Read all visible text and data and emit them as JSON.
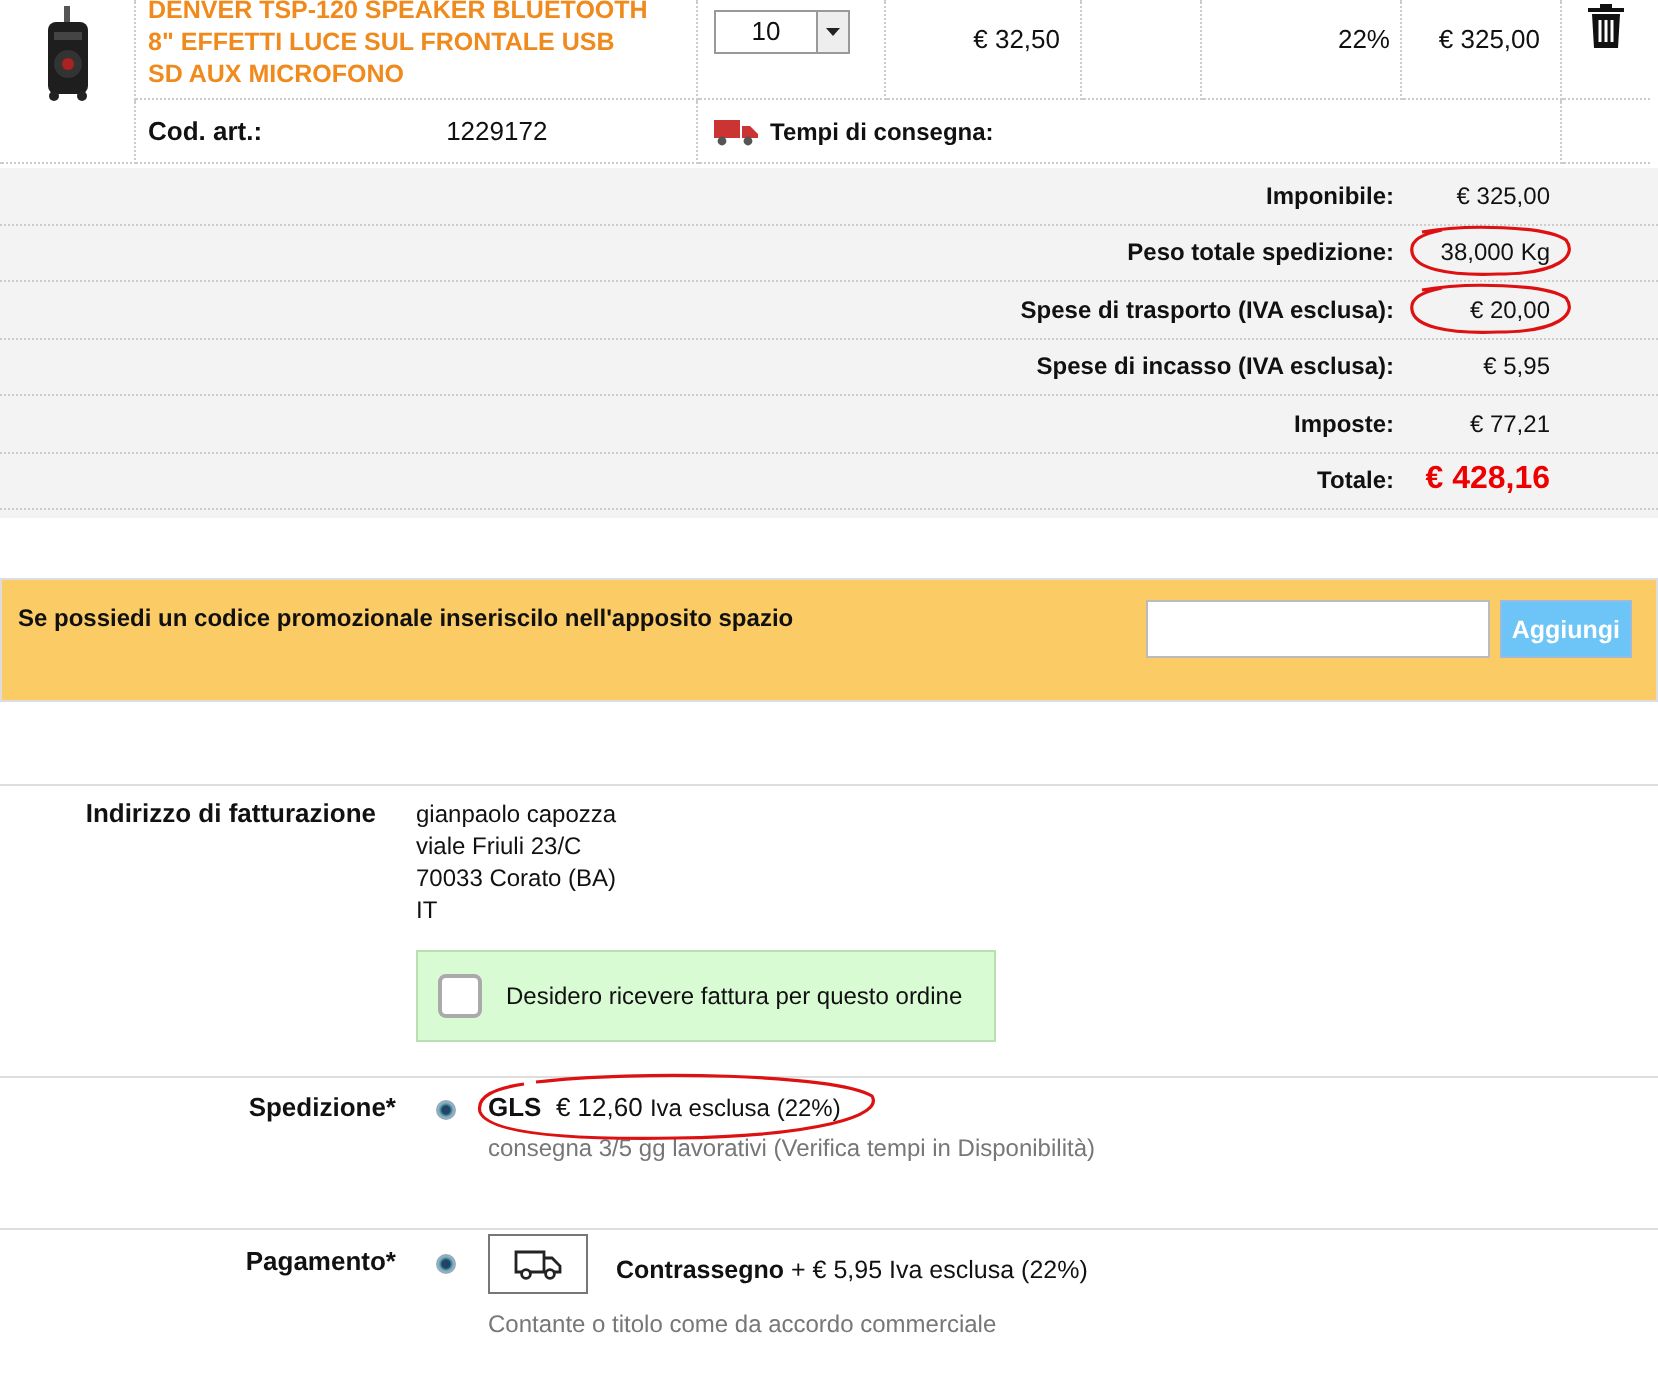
{
  "product": {
    "name": "DENVER TSP-120 SPEAKER BLUETOOTH 8\" EFFETTI LUCE SUL FRONTALE USB SD AUX MICROFONO",
    "quantity": "10",
    "unit_price": "€ 32,50",
    "vat": "22%",
    "total": "€ 325,00",
    "code_label": "Cod. art.:",
    "code": "1229172",
    "delivery_label": "Tempi di consegna:"
  },
  "summary": [
    {
      "label": "Imponibile:",
      "value": "€ 325,00",
      "kind": "normal",
      "circled": false
    },
    {
      "label": "Peso totale spedizione:",
      "value": "38,000 Kg",
      "kind": "normal",
      "circled": true
    },
    {
      "label": "Spese di trasporto (IVA esclusa):",
      "value": "€ 20,00",
      "kind": "normal",
      "circled": true
    },
    {
      "label": "Spese di incasso (IVA esclusa):",
      "value": "€ 5,95",
      "kind": "normal",
      "circled": false
    },
    {
      "label": "Imposte:",
      "value": "€ 77,21",
      "kind": "normal",
      "circled": false
    },
    {
      "label": "Totale:",
      "value": "€ 428,16",
      "kind": "total",
      "circled": false
    }
  ],
  "promo": {
    "text": "Se possiedi un codice promozionale inseriscilo nell'apposito spazio",
    "button": "Aggiungi"
  },
  "billing": {
    "label": "Indirizzo di fatturazione",
    "address": [
      "gianpaolo capozza",
      "viale Friuli 23/C",
      "70033 Corato (BA)",
      "IT"
    ],
    "invoice": {
      "label": "Desidero ricevere fattura per questo ordine",
      "checked": false
    }
  },
  "shipping": {
    "label": "Spedizione*",
    "options": [
      {
        "name": "GLS",
        "price": "€ 12,60",
        "note": "Iva esclusa (22%)",
        "description": "consegna 3/5 gg lavorativi (Verifica tempi in Disponibilità)",
        "selected": true,
        "circled": true
      }
    ]
  },
  "payment": {
    "label": "Pagamento*",
    "options": [
      {
        "name": "Contrassegno",
        "price": "+ € 5,95",
        "note": "Iva esclusa (22%)",
        "description": "Contante o titolo come da accordo commerciale",
        "selected": true
      }
    ]
  }
}
